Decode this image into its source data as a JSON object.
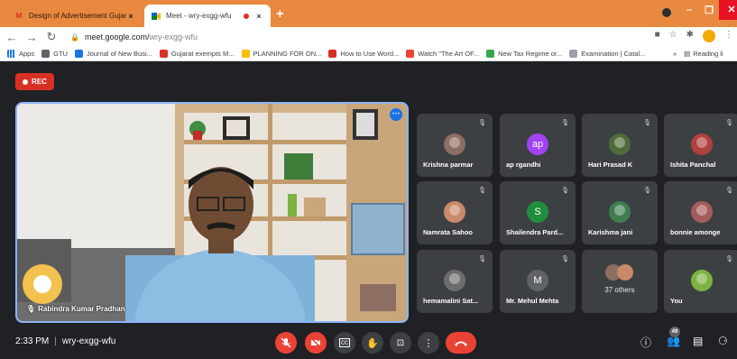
{
  "browser": {
    "tabs": [
      {
        "title": "Design of Advertisement Gujarat",
        "favicon": "gmail-icon",
        "active": false
      },
      {
        "title": "Meet - wry-exgg-wfu",
        "favicon": "meet-icon",
        "active": true,
        "recording": true
      }
    ],
    "new_tab_label": "+",
    "address": {
      "host": "meet.google.com/",
      "path": "wry-exgg-wfu"
    },
    "bookmarks": [
      {
        "label": "Apps",
        "color": "#1a73e8"
      },
      {
        "label": "GTU",
        "color": "#5f6368"
      },
      {
        "label": "Journal of New Busi...",
        "color": "#1a73e8"
      },
      {
        "label": "Gujarat exempts M...",
        "color": "#d93025"
      },
      {
        "label": "PLANNING FOR ON...",
        "color": "#fbbc04"
      },
      {
        "label": "How to Use Word...",
        "color": "#d93025"
      },
      {
        "label": "Watch \"The Art OF...",
        "color": "#ea4335"
      },
      {
        "label": "New Tax Regime or...",
        "color": "#34a853"
      },
      {
        "label": "Examination | Catal...",
        "color": "#9aa0a6"
      }
    ],
    "bookmarks_overflow": "»",
    "reading_list_label": "Reading li"
  },
  "meet": {
    "rec_label": "REC",
    "speaker": {
      "name": "Rabindra Kumar Pradhan"
    },
    "participants": [
      {
        "name": "Krishna parmar",
        "avatar_type": "photo",
        "color": "#8d6e63"
      },
      {
        "name": "ap rgandhi",
        "avatar_type": "initials",
        "initials": "ap",
        "color": "#a142f4"
      },
      {
        "name": "Hari Prasad K",
        "avatar_type": "photo",
        "color": "#4e6b3a"
      },
      {
        "name": "Ishita Panchal",
        "avatar_type": "photo",
        "color": "#b0413e"
      },
      {
        "name": "Namrata Sahoo",
        "avatar_type": "photo",
        "color": "#c98a6a"
      },
      {
        "name": "Shailendra Pard...",
        "avatar_type": "initials",
        "initials": "S",
        "color": "#1e8e3e"
      },
      {
        "name": "Karishma jani",
        "avatar_type": "photo",
        "color": "#3f7d4f"
      },
      {
        "name": "bonnie amonge",
        "avatar_type": "photo",
        "color": "#a65c5c"
      },
      {
        "name": "hemamalini Sat...",
        "avatar_type": "photo",
        "color": "#6d6d6d"
      },
      {
        "name": "Mr. Mehul Mehta",
        "avatar_type": "initials",
        "initials": "M",
        "color": "#5f6368"
      },
      {
        "name": "37 others",
        "avatar_type": "group",
        "color": "#8d6e63"
      },
      {
        "name": "You",
        "avatar_type": "photo",
        "color": "#7cb342"
      }
    ]
  },
  "callbar": {
    "time": "2:33 PM",
    "separator": "|",
    "meeting_code": "wry-exgg-wfu",
    "people_count": "49"
  }
}
